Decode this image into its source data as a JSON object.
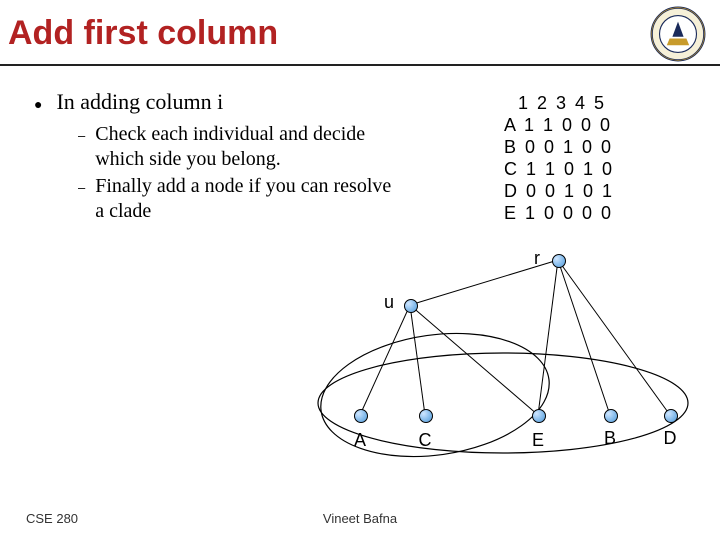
{
  "title": "Add first column",
  "bullets": {
    "l1": "In adding column i",
    "l2a": "Check each individual and decide which side you belong.",
    "l2b": "Finally add a node if you can resolve a clade"
  },
  "matrix": {
    "header": "  1 2 3 4 5",
    "rows": [
      "A 1 1 0 0 0",
      "B 0 0 1 0 0",
      "C 1 1 0 1 0",
      "D 0 0 1 0 1",
      "E 1 0 0 0 0"
    ]
  },
  "labels": {
    "r": "r",
    "u": "u",
    "A": "A",
    "B": "B",
    "C": "C",
    "D": "D",
    "E": "E"
  },
  "footer": {
    "left": "CSE 280",
    "center": "Vineet Bafna"
  }
}
